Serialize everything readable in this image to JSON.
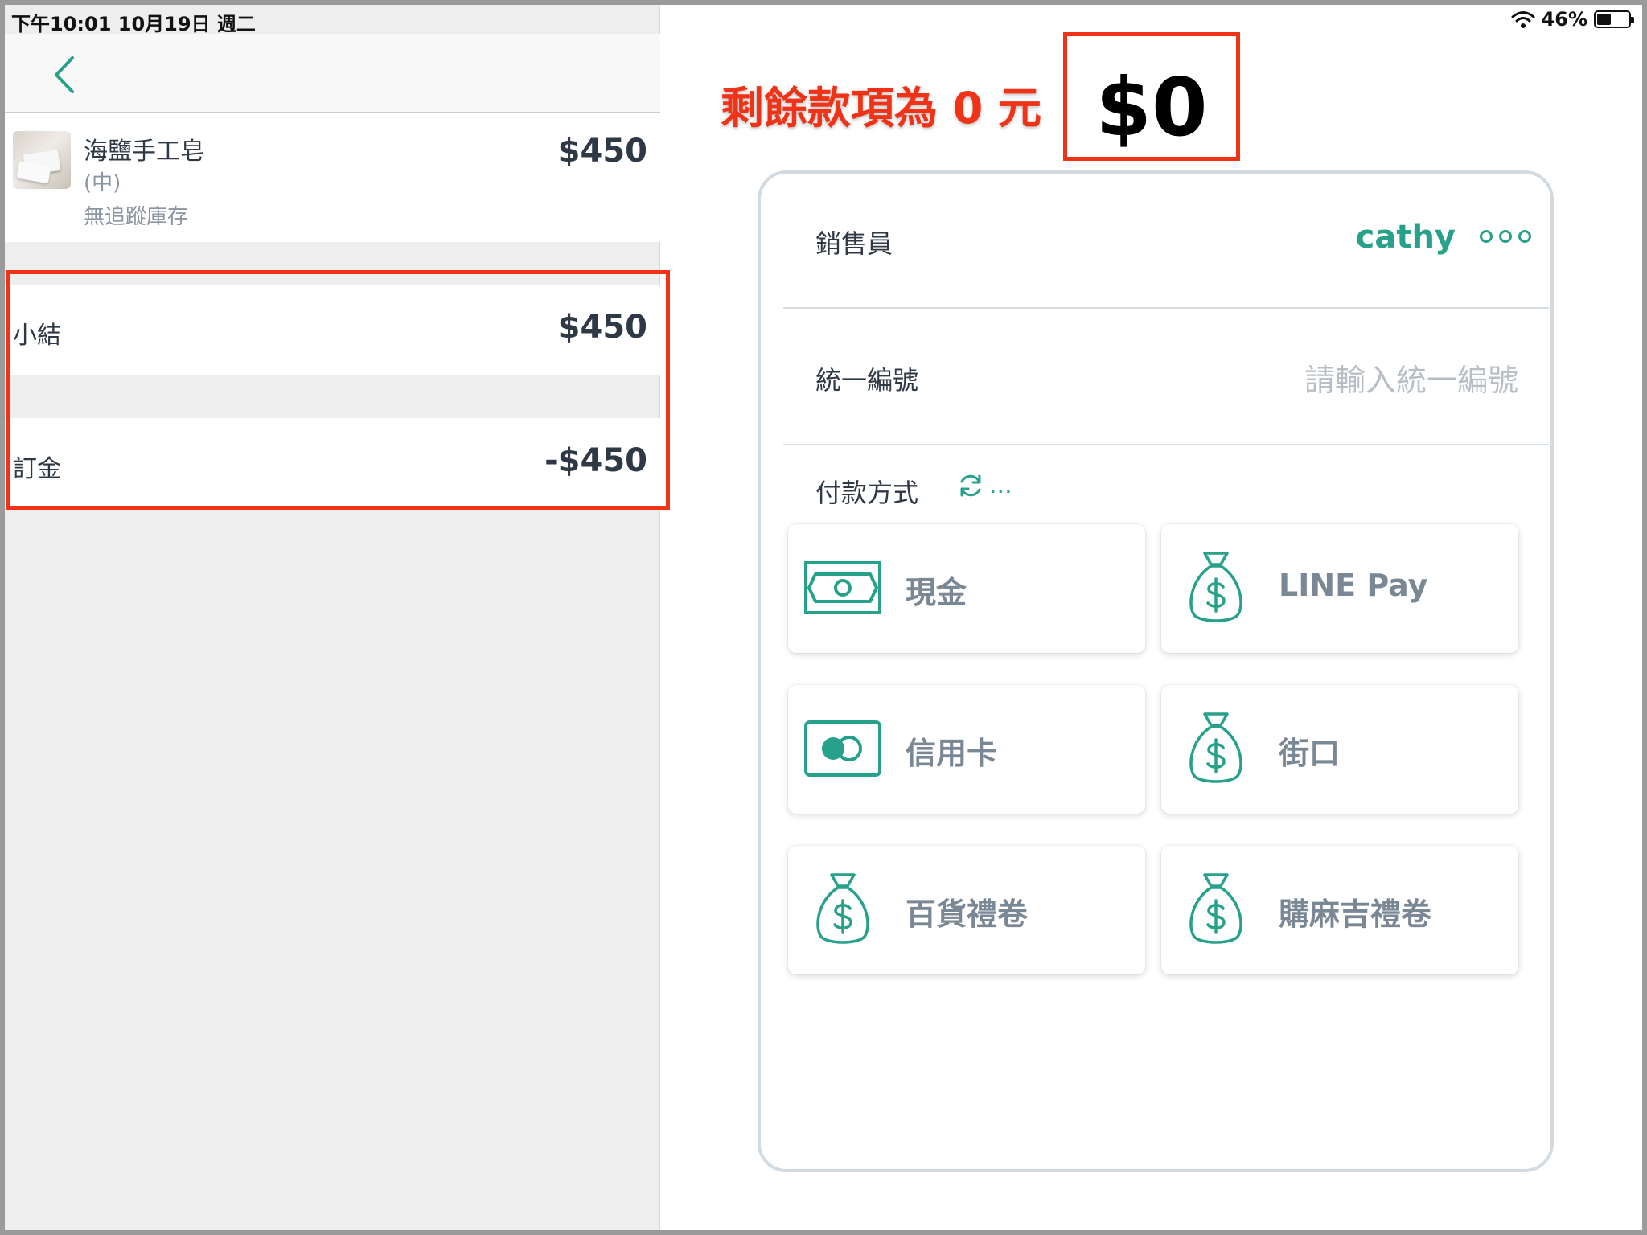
{
  "status_bar": {
    "time_date": "下午10:01   10月19日 週二",
    "battery_text": "46%",
    "battery_level": 0.46
  },
  "order": {
    "item": {
      "name": "海鹽手工皂",
      "variant": "(中)",
      "stock_note": "無追蹤庫存",
      "price": "$450"
    },
    "subtotal": {
      "label": "小結",
      "value": "$450"
    },
    "deposit": {
      "label": "訂金",
      "value": "-$450"
    }
  },
  "annotation": "剩餘款項為 0 元",
  "total_due": "$0",
  "checkout": {
    "salesperson_label": "銷售員",
    "salesperson_value": "cathy",
    "tax_id_label": "統一編號",
    "tax_id_placeholder": "請輸入統一編號",
    "payment_title": "付款方式",
    "payment_sync_text": "...",
    "payment_methods": [
      {
        "label": "現金",
        "icon": "cash-icon"
      },
      {
        "label": "LINE Pay",
        "icon": "money-bag-icon"
      },
      {
        "label": "信用卡",
        "icon": "credit-card-icon"
      },
      {
        "label": "街口",
        "icon": "money-bag-icon"
      },
      {
        "label": "百貨禮卷",
        "icon": "money-bag-icon"
      },
      {
        "label": "購麻吉禮卷",
        "icon": "money-bag-icon"
      }
    ]
  },
  "colors": {
    "accent": "#27a18a",
    "highlight": "#f03217",
    "text_dark": "#2f3845",
    "text_muted": "#8a94a2"
  }
}
